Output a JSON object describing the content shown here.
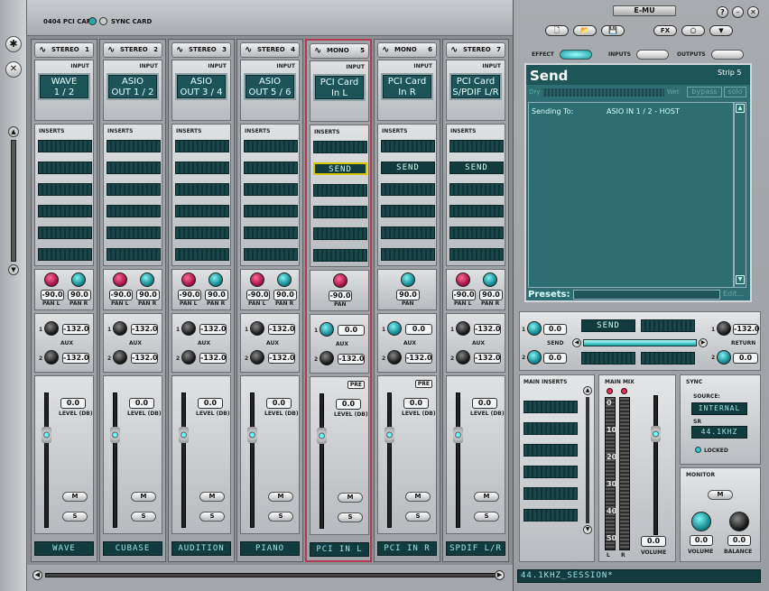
{
  "top": {
    "pci_card": "0404 PCI CARD",
    "sync_card": "SYNC CARD",
    "logo": "E-MU"
  },
  "strips": [
    {
      "type": "STEREO",
      "num": "1",
      "input": "WAVE\n1 / 2",
      "pan": [
        {
          "label": "PAN L",
          "value": "-90.0",
          "color": "red"
        },
        {
          "label": "PAN R",
          "value": "90.0",
          "color": "teal"
        }
      ],
      "aux1": "-132.0",
      "aux2": "-132.0",
      "level": "0.0",
      "name": "WAVE",
      "inserts": [
        "",
        "",
        "",
        "",
        "",
        ""
      ],
      "selected": false,
      "pre": false,
      "aux_knob": "black"
    },
    {
      "type": "STEREO",
      "num": "2",
      "input": "ASIO\nOUT 1 / 2",
      "pan": [
        {
          "label": "PAN L",
          "value": "-90.0",
          "color": "red"
        },
        {
          "label": "PAN R",
          "value": "90.0",
          "color": "teal"
        }
      ],
      "aux1": "-132.0",
      "aux2": "-132.0",
      "level": "0.0",
      "name": "CUBASE",
      "inserts": [
        "",
        "",
        "",
        "",
        "",
        ""
      ],
      "selected": false,
      "pre": false,
      "aux_knob": "black"
    },
    {
      "type": "STEREO",
      "num": "3",
      "input": "ASIO\nOUT 3 / 4",
      "pan": [
        {
          "label": "PAN L",
          "value": "-90.0",
          "color": "red"
        },
        {
          "label": "PAN R",
          "value": "90.0",
          "color": "teal"
        }
      ],
      "aux1": "-132.0",
      "aux2": "-132.0",
      "level": "0.0",
      "name": "AUDITION",
      "inserts": [
        "",
        "",
        "",
        "",
        "",
        ""
      ],
      "selected": false,
      "pre": false,
      "aux_knob": "black"
    },
    {
      "type": "STEREO",
      "num": "4",
      "input": "ASIO\nOUT 5 / 6",
      "pan": [
        {
          "label": "PAN L",
          "value": "-90.0",
          "color": "red"
        },
        {
          "label": "PAN R",
          "value": "90.0",
          "color": "teal"
        }
      ],
      "aux1": "-132.0",
      "aux2": "-132.0",
      "level": "0.0",
      "name": "PIANO",
      "inserts": [
        "",
        "",
        "",
        "",
        "",
        ""
      ],
      "selected": false,
      "pre": false,
      "aux_knob": "black"
    },
    {
      "type": "MONO",
      "num": "5",
      "input": "PCI Card\nIn L",
      "pan": [
        {
          "label": "PAN",
          "value": "-90.0",
          "color": "red"
        }
      ],
      "aux1": "0.0",
      "aux2": "-132.0",
      "level": "0.0",
      "name": "PCI IN L",
      "inserts": [
        "",
        "SEND",
        "",
        "",
        "",
        ""
      ],
      "selected": true,
      "pre": true,
      "aux_knob": "teal"
    },
    {
      "type": "MONO",
      "num": "6",
      "input": "PCI Card\nIn R",
      "pan": [
        {
          "label": "PAN",
          "value": "90.0",
          "color": "teal"
        }
      ],
      "aux1": "0.0",
      "aux2": "-132.0",
      "level": "0.0",
      "name": "PCI IN R",
      "inserts": [
        "",
        "SEND",
        "",
        "",
        "",
        ""
      ],
      "selected": false,
      "pre": true,
      "aux_knob": "teal"
    },
    {
      "type": "STEREO",
      "num": "7",
      "input": "PCI Card\nS/PDIF L/R",
      "pan": [
        {
          "label": "PAN L",
          "value": "-90.0",
          "color": "red"
        },
        {
          "label": "PAN R",
          "value": "90.0",
          "color": "teal"
        }
      ],
      "aux1": "-132.0",
      "aux2": "-132.0",
      "level": "0.0",
      "name": "SPDIF L/R",
      "inserts": [
        "",
        "SEND",
        "",
        "",
        "",
        ""
      ],
      "selected": false,
      "pre": false,
      "aux_knob": "black"
    }
  ],
  "labels": {
    "input": "INPUT",
    "inserts": "INSERTS",
    "aux": "AUX",
    "level": "LEVEL (DB)",
    "mute": "M",
    "solo": "S",
    "pre": "PRE"
  },
  "tabs": {
    "effect": "EFFECT",
    "inputs": "INPUTS",
    "outputs": "OUTPUTS"
  },
  "effect_panel": {
    "title": "Send",
    "strip": "Strip 5",
    "dry": "Dry",
    "wet": "Wet",
    "bypass": "bypass",
    "solo": "solo",
    "sending_to_label": "Sending To:",
    "sending_to_value": "ASIO IN 1 / 2 - HOST",
    "presets": "Presets:",
    "edit": "Edit..."
  },
  "send_section": {
    "send_knob1": "0.0",
    "send_knob2": "0.0",
    "send_label": "SEND",
    "send_lcd": "SEND",
    "return_label": "RETURN",
    "return1": "-132.0",
    "return2": "0.0"
  },
  "main_inserts": {
    "title": "MAIN INSERTS"
  },
  "main_mix": {
    "title": "MAIN MIX",
    "scale": [
      "0",
      "10",
      "20",
      "30",
      "40",
      "50"
    ],
    "volume": "0.0",
    "volume_label": "VOLUME"
  },
  "sync": {
    "title": "SYNC",
    "source_label": "SOURCE:",
    "source": "INTERNAL",
    "sr_label": "SR",
    "sr": "44.1KHZ",
    "locked": "LOCKED"
  },
  "monitor": {
    "title": "MONITOR",
    "mute": "M",
    "volume": "0.0",
    "balance": "0.0",
    "volume_label": "VOLUME",
    "balance_label": "BALANCE"
  },
  "session": "44.1KHZ_SESSION*",
  "toolbar": {
    "fx": "FX",
    "help": "?"
  }
}
